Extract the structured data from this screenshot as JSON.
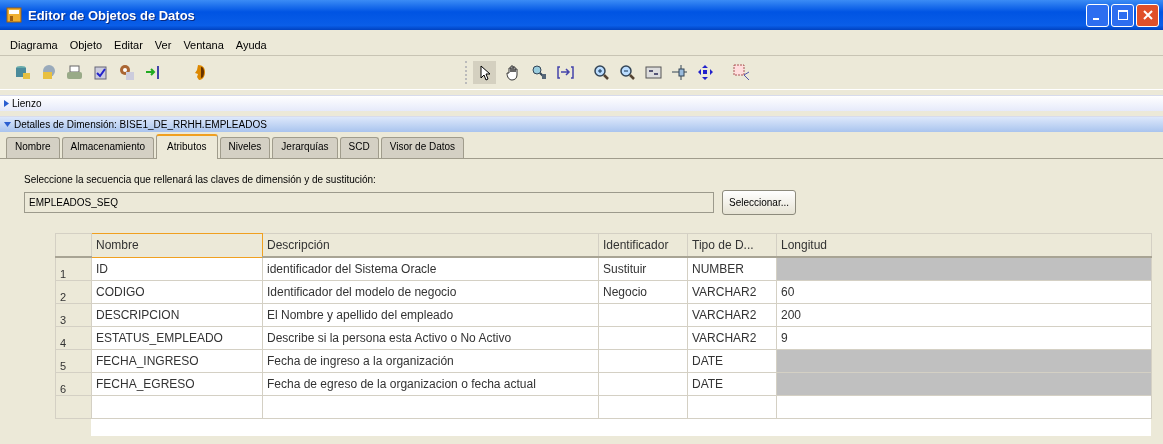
{
  "window": {
    "title": "Editor de Objetos de Datos"
  },
  "menu": [
    {
      "label": "Diagrama"
    },
    {
      "label": "Objeto"
    },
    {
      "label": "Editar"
    },
    {
      "label": "Ver"
    },
    {
      "label": "Ventana"
    },
    {
      "label": "Ayuda"
    }
  ],
  "sections": [
    {
      "label": "Lienzo",
      "expanded": false
    },
    {
      "label": "Detalles de Dimensión: BISE1_DE_RRHH.EMPLEADOS",
      "expanded": true
    }
  ],
  "tabs": [
    {
      "label": "Nombre",
      "selected": false
    },
    {
      "label": "Almacenamiento",
      "selected": false
    },
    {
      "label": "Atributos",
      "selected": true
    },
    {
      "label": "Niveles",
      "selected": false
    },
    {
      "label": "Jerarquías",
      "selected": false
    },
    {
      "label": "SCD",
      "selected": false
    },
    {
      "label": "Visor de Datos",
      "selected": false
    }
  ],
  "sequence": {
    "label": "Seleccione la secuencia que rellenará las claves de dimensión y de sustitución:",
    "value": "EMPLEADOS_SEQ",
    "button": "Seleccionar..."
  },
  "table": {
    "columns": [
      "Nombre",
      "Descripción",
      "Identificador",
      "Tipo de D...",
      "Longitud"
    ],
    "rows": [
      {
        "number": "1",
        "cells": [
          "ID",
          "identificador del Sistema Oracle",
          "Sustituir",
          "NUMBER"
        ],
        "length_disabled": true
      },
      {
        "number": "2",
        "cells": [
          "CODIGO",
          "Identificador del modelo de negocio",
          "Negocio",
          "VARCHAR2",
          "60"
        ],
        "length_disabled": false
      },
      {
        "number": "3",
        "cells": [
          "DESCRIPCION",
          "El Nombre y apellido del empleado",
          "",
          "VARCHAR2",
          "200"
        ],
        "length_disabled": false
      },
      {
        "number": "4",
        "cells": [
          "ESTATUS_EMPLEADO",
          "Describe si la persona esta Activo o No Activo",
          "",
          "VARCHAR2",
          "9"
        ],
        "length_disabled": false
      },
      {
        "number": "5",
        "cells": [
          "FECHA_INGRESO",
          "Fecha de ingreso a la organización",
          "",
          "DATE"
        ],
        "length_disabled": true
      },
      {
        "number": "6",
        "cells": [
          "FECHA_EGRESO",
          "Fecha de egreso de la organizacion o fecha actual",
          "",
          "DATE"
        ],
        "length_disabled": true
      }
    ]
  }
}
